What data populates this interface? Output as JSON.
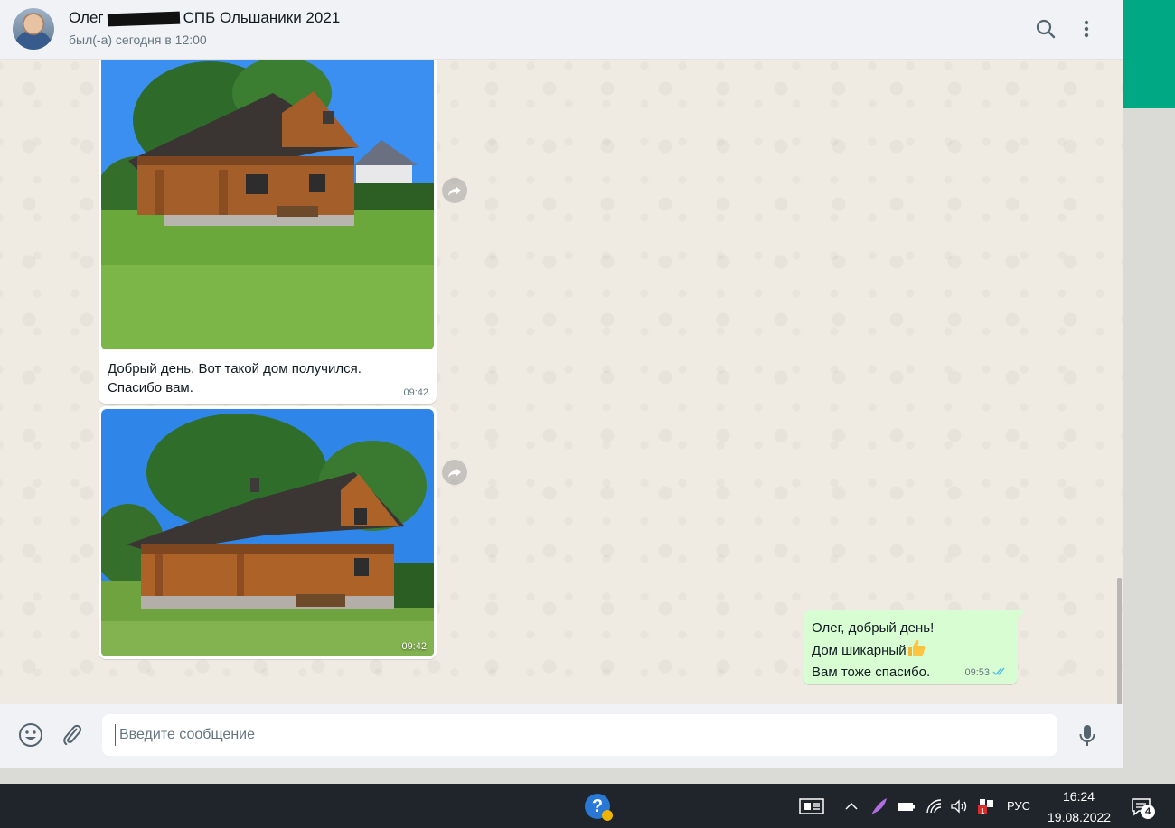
{
  "header": {
    "contact_name_prefix": "Олег",
    "contact_name_suffix": "СПБ Ольшаники 2021",
    "status": "был(-а) сегодня в 12:00",
    "search_icon": "search-icon",
    "menu_icon": "more-vert-icon"
  },
  "messages": [
    {
      "direction": "incoming",
      "type": "image",
      "image": "log-house-photo-1",
      "caption_lines": [
        "Добрый день. Вот такой дом получился.",
        "Спасибо вам."
      ],
      "time": "09:42"
    },
    {
      "direction": "incoming",
      "type": "image",
      "image": "log-house-photo-2",
      "time": "09:42"
    },
    {
      "direction": "outgoing",
      "type": "text",
      "lines": [
        "Олег, добрый день!",
        "Дом шикарный",
        "Вам тоже спасибо."
      ],
      "emoji": "thumbs-up",
      "time": "09:53",
      "status": "read"
    }
  ],
  "composer": {
    "placeholder": "Введите сообщение",
    "emoji_icon": "emoji-icon",
    "attach_icon": "paperclip-icon",
    "mic_icon": "microphone-icon"
  },
  "taskbar": {
    "language": "РУС",
    "time": "16:24",
    "date": "19.08.2022",
    "notification_count": "4"
  },
  "colors": {
    "accent": "#00a884",
    "outgoing_bubble": "#d9fdd3",
    "chat_background": "#efeae2",
    "read_ticks": "#53bdeb"
  }
}
